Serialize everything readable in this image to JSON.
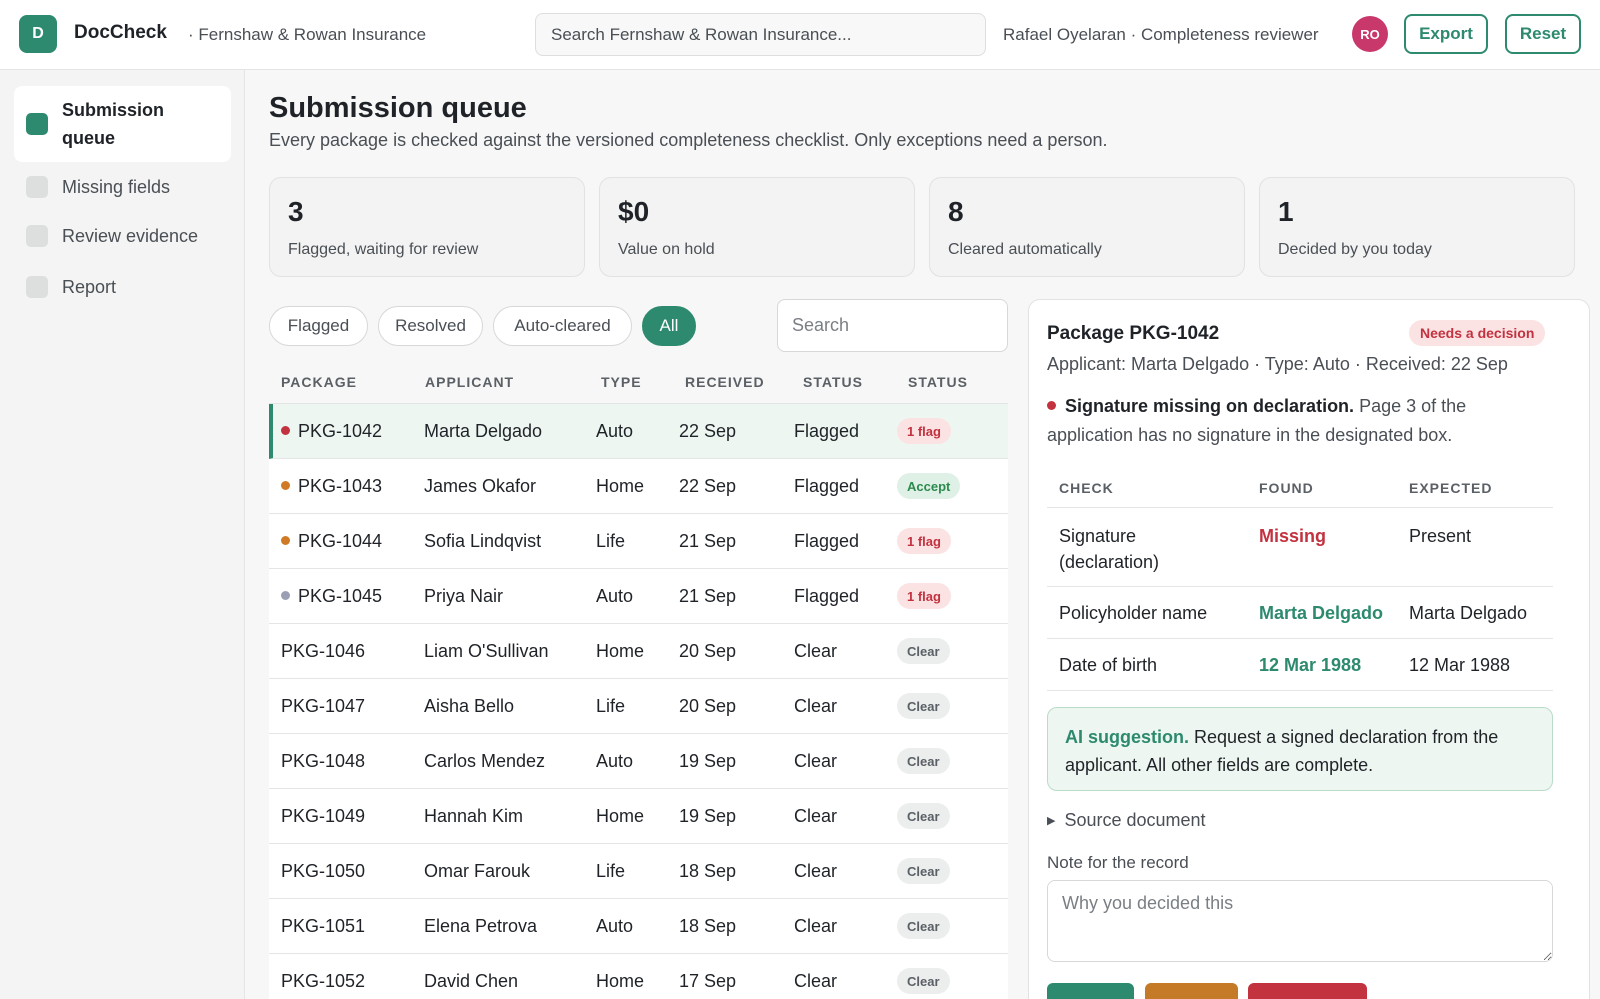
{
  "topbar": {
    "logo_letter": "D",
    "brand": "DocCheck",
    "org": "· Fernshaw & Rowan Insurance",
    "search_placeholder": "Search Fernshaw & Rowan Insurance...",
    "user": "Rafael Oyelaran · Completeness reviewer",
    "avatar_initials": "RO",
    "export_label": "Export",
    "reset_label": "Reset"
  },
  "sidebar": {
    "items": [
      {
        "label": "Submission queue",
        "active": true
      },
      {
        "label": "Missing fields",
        "active": false
      },
      {
        "label": "Review evidence",
        "active": false
      },
      {
        "label": "Report",
        "active": false
      }
    ]
  },
  "main": {
    "title": "Submission queue",
    "subtitle": "Every package is checked against the versioned completeness checklist. Only exceptions need a person."
  },
  "stats": [
    {
      "value": "3",
      "label": "Flagged, waiting for review"
    },
    {
      "value": "$0",
      "label": "Value on hold"
    },
    {
      "value": "8",
      "label": "Cleared automatically"
    },
    {
      "value": "1",
      "label": "Decided by you today"
    }
  ],
  "filters": {
    "chips": [
      {
        "label": "Flagged",
        "active": false
      },
      {
        "label": "Resolved",
        "active": false
      },
      {
        "label": "Auto-cleared",
        "active": false
      },
      {
        "label": "All",
        "active": true
      }
    ],
    "search_placeholder": "Search"
  },
  "table": {
    "headers": [
      "PACKAGE",
      "APPLICANT",
      "TYPE",
      "RECEIVED",
      "STATUS",
      "STATUS"
    ],
    "rows": [
      {
        "package": "PKG-1042",
        "applicant": "Marta Delgado",
        "type": "Auto",
        "received": "22 Sep",
        "status": "Flagged",
        "badge": "1 flag",
        "badge_kind": "flag",
        "dot": "#c2323f",
        "selected": true
      },
      {
        "package": "PKG-1043",
        "applicant": "James Okafor",
        "type": "Home",
        "received": "22 Sep",
        "status": "Flagged",
        "badge": "Accept",
        "badge_kind": "accept",
        "dot": "#d07a26",
        "selected": false
      },
      {
        "package": "PKG-1044",
        "applicant": "Sofia Lindqvist",
        "type": "Life",
        "received": "21 Sep",
        "status": "Flagged",
        "badge": "1 flag",
        "badge_kind": "flag",
        "dot": "#d07a26",
        "selected": false
      },
      {
        "package": "PKG-1045",
        "applicant": "Priya Nair",
        "type": "Auto",
        "received": "21 Sep",
        "status": "Flagged",
        "badge": "1 flag",
        "badge_kind": "flag",
        "dot": "#9a9fb3",
        "selected": false
      },
      {
        "package": "PKG-1046",
        "applicant": "Liam O'Sullivan",
        "type": "Home",
        "received": "20 Sep",
        "status": "Clear",
        "badge": "Clear",
        "badge_kind": "clear",
        "dot": "",
        "selected": false
      },
      {
        "package": "PKG-1047",
        "applicant": "Aisha Bello",
        "type": "Life",
        "received": "20 Sep",
        "status": "Clear",
        "badge": "Clear",
        "badge_kind": "clear",
        "dot": "",
        "selected": false
      },
      {
        "package": "PKG-1048",
        "applicant": "Carlos Mendez",
        "type": "Auto",
        "received": "19 Sep",
        "status": "Clear",
        "badge": "Clear",
        "badge_kind": "clear",
        "dot": "",
        "selected": false
      },
      {
        "package": "PKG-1049",
        "applicant": "Hannah Kim",
        "type": "Home",
        "received": "19 Sep",
        "status": "Clear",
        "badge": "Clear",
        "badge_kind": "clear",
        "dot": "",
        "selected": false
      },
      {
        "package": "PKG-1050",
        "applicant": "Omar Farouk",
        "type": "Life",
        "received": "18 Sep",
        "status": "Clear",
        "badge": "Clear",
        "badge_kind": "clear",
        "dot": "",
        "selected": false
      },
      {
        "package": "PKG-1051",
        "applicant": "Elena Petrova",
        "type": "Auto",
        "received": "18 Sep",
        "status": "Clear",
        "badge": "Clear",
        "badge_kind": "clear",
        "dot": "",
        "selected": false
      },
      {
        "package": "PKG-1052",
        "applicant": "David Chen",
        "type": "Home",
        "received": "17 Sep",
        "status": "Clear",
        "badge": "Clear",
        "badge_kind": "clear",
        "dot": "",
        "selected": false
      }
    ]
  },
  "detail": {
    "title": "Package PKG-1042",
    "badge": "Needs a decision",
    "meta": "Applicant: Marta Delgado · Type: Auto · Received: 22 Sep",
    "issue_title": "Signature missing on declaration.",
    "issue_text": "Page 3 of the application has no signature in the designated box.",
    "check_headers": [
      "CHECK",
      "FOUND",
      "EXPECTED"
    ],
    "checks": [
      {
        "check": "Signature (declaration)",
        "found": "Missing",
        "found_kind": "missing",
        "expected": "Present"
      },
      {
        "check": "Policyholder name",
        "found": "Marta Delgado",
        "found_kind": "match",
        "expected": "Marta Delgado"
      },
      {
        "check": "Date of birth",
        "found": "12 Mar 1988",
        "found_kind": "match",
        "expected": "12 Mar 1988"
      }
    ],
    "ai_label": "AI suggestion.",
    "ai_text": "Request a signed declaration from the applicant. All other fields are complete.",
    "source_label": "Source document",
    "note_label": "Note for the record",
    "note_placeholder": "Why you decided this"
  },
  "colors": {
    "accent": "#2d8a6e",
    "danger": "#c2323f",
    "warning": "#d07a26"
  }
}
